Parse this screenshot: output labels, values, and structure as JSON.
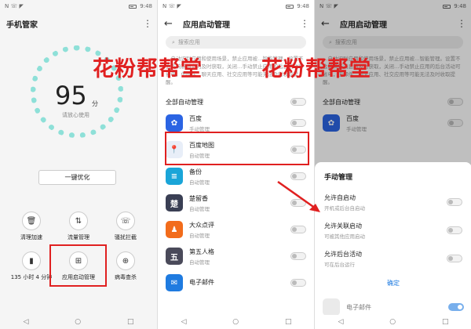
{
  "status": {
    "time": "9:48",
    "signal": "N ☏ ◤"
  },
  "panel1": {
    "title": "手机管家",
    "score": "95",
    "score_unit": "分",
    "score_sub": "请放心使用",
    "optimize_button": "一键优化",
    "tools": [
      {
        "label": "清理加速",
        "icon": "trash-icon",
        "glyph": "🗑"
      },
      {
        "label": "流量管理",
        "icon": "data-transfer-icon",
        "glyph": "⇅"
      },
      {
        "label": "骚扰拦截",
        "icon": "phone-block-icon",
        "glyph": "☏"
      },
      {
        "label": "135 小时 4 分钟",
        "icon": "battery-icon",
        "glyph": "▮"
      },
      {
        "label": "应用启动管理",
        "icon": "app-launch-icon",
        "glyph": "⊞"
      },
      {
        "label": "病毒查杀",
        "icon": "virus-scan-icon",
        "glyph": "⊕"
      }
    ]
  },
  "panel2": {
    "title": "应用启动管理",
    "search_placeholder": "搜索应用",
    "description": "…自动识别应用和使用场景，禁止应用被…智能管理。设置不会影响新消息的及时获取，关闭…手动禁止应用的后台活动可省电，但邮件、聊天应用、社交应用等可能无法及时收取提醒。",
    "all_label": "全部自动管理",
    "apps": [
      {
        "name": "百度",
        "sub": "手动管理",
        "color": "#2b64e3",
        "glyph": "✿",
        "on": false
      },
      {
        "name": "百度地图",
        "sub": "自动管理",
        "color": "#e8eef8",
        "glyph": "📍",
        "on": false
      },
      {
        "name": "备份",
        "sub": "自动管理",
        "color": "#1aa5d8",
        "glyph": "≡",
        "on": false
      },
      {
        "name": "楚留香",
        "sub": "自动管理",
        "color": "#3a3f54",
        "glyph": "楚",
        "on": false
      },
      {
        "name": "大众点评",
        "sub": "自动管理",
        "color": "#f26c1b",
        "glyph": "♟",
        "on": false
      },
      {
        "name": "第五人格",
        "sub": "自动管理",
        "color": "#4a4a5a",
        "glyph": "五",
        "on": false
      },
      {
        "name": "电子邮件",
        "sub": "",
        "color": "#1f7be0",
        "glyph": "✉",
        "on": false
      }
    ]
  },
  "panel3": {
    "title": "应用启动管理",
    "search_placeholder": "搜索应用",
    "description": "…自动识别应用和使用场景，禁止应用被…智能管理。设置不会影响新消息的及时获取，关闭…手动禁止应用的后台活动可省电，但邮件、聊天应用、社交应用等可能无法及时收取提醒。",
    "all_label": "全部自动管理",
    "app_name": "百度",
    "app_sub": "手动管理",
    "sheet": {
      "title": "手动管理",
      "options": [
        {
          "name": "允许自启动",
          "sub": "开机或后台自启动"
        },
        {
          "name": "允许关联启动",
          "sub": "可被其他应用启动"
        },
        {
          "name": "允许后台活动",
          "sub": "可在后台运行"
        }
      ],
      "confirm": "确定"
    },
    "bottom_app": "电子邮件"
  },
  "watermark": "花粉帮帮堂",
  "colors": {
    "accent": "#1f7be0",
    "highlight": "#e02020",
    "ring": "#8ee0d8"
  },
  "nav": {
    "back": "◁",
    "home": "○",
    "recent": "□"
  }
}
